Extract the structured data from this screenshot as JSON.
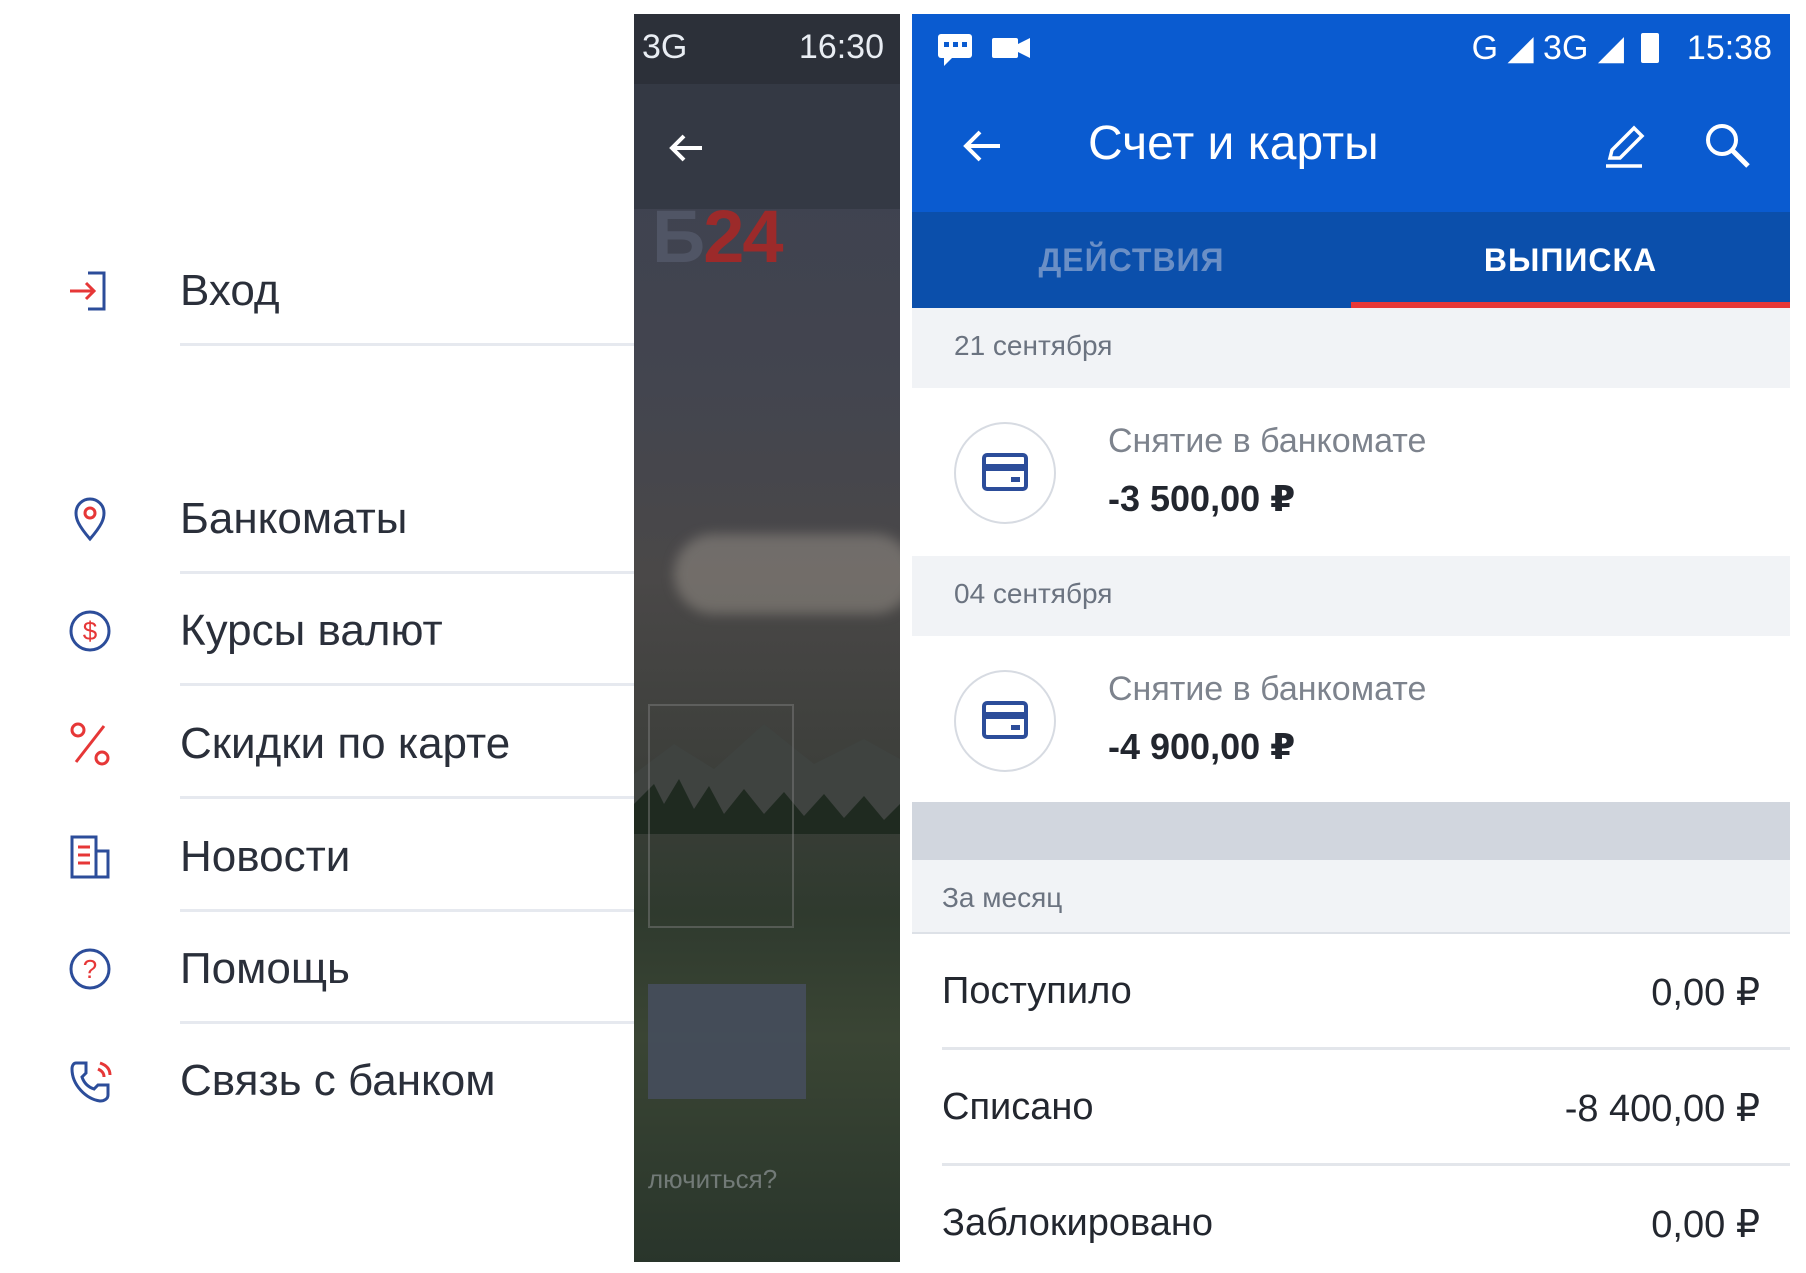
{
  "left_screen": {
    "status_bar": {
      "network": "3G",
      "time": "16:30"
    },
    "logo": {
      "part1": "Б",
      "part2": "24"
    },
    "forgot_text": "лючиться?",
    "menu": [
      {
        "label": "Вход",
        "icon": "login-icon"
      },
      {
        "label": "Банкоматы",
        "icon": "location-pin-icon"
      },
      {
        "label": "Курсы валют",
        "icon": "currency-dollar-icon"
      },
      {
        "label": "Скидки по карте",
        "icon": "percent-icon"
      },
      {
        "label": "Новости",
        "icon": "news-icon"
      },
      {
        "label": "Помощь",
        "icon": "help-icon"
      },
      {
        "label": "Связь с банком",
        "icon": "phone-call-icon"
      }
    ],
    "colors": {
      "icon_primary": "#2c4d9a",
      "icon_accent": "#e63737",
      "text": "#2a2f3a"
    }
  },
  "right_screen": {
    "status_bar": {
      "network": "G ◢ 3G ◢",
      "time": "15:38"
    },
    "app_bar": {
      "title": "Счет и карты"
    },
    "tabs": [
      {
        "label": "ДЕЙСТВИЯ",
        "active": false
      },
      {
        "label": "ВЫПИСКА",
        "active": true
      }
    ],
    "transactions": [
      {
        "date": "21 сентября",
        "title": "Снятие в банкомате",
        "amount": "-3 500,00 ₽"
      },
      {
        "date": "04 сентября",
        "title": "Снятие в банкомате",
        "amount": "-4 900,00 ₽"
      }
    ],
    "summary": {
      "header": "За месяц",
      "rows": [
        {
          "label": "Поступило",
          "value": "0,00 ₽"
        },
        {
          "label": "Списано",
          "value": "-8 400,00 ₽"
        },
        {
          "label": "Заблокировано",
          "value": "0,00 ₽"
        }
      ]
    },
    "colors": {
      "primary": "#0a5bd0",
      "tab_bar": "#0b4fab",
      "tab_indicator": "#e63737",
      "background": "#f1f3f6"
    }
  }
}
